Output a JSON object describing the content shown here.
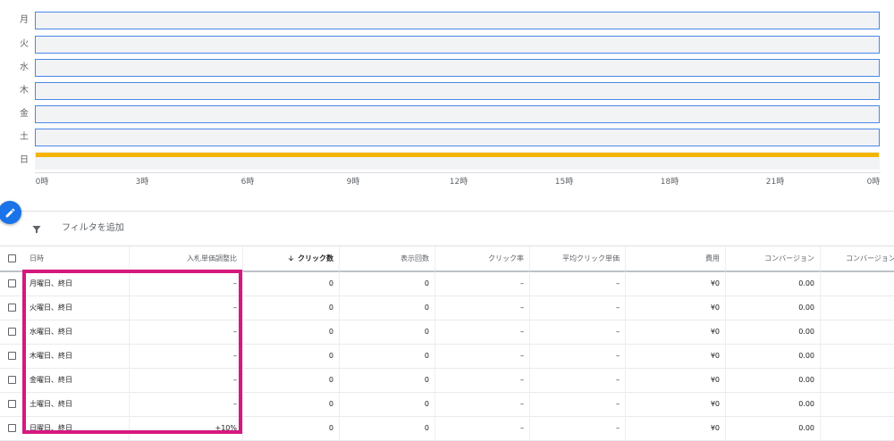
{
  "schedule": {
    "days": [
      "月",
      "火",
      "水",
      "木",
      "金",
      "土",
      "日"
    ],
    "highlighted_day_index": 6,
    "ticks": [
      "0時",
      "3時",
      "6時",
      "9時",
      "12時",
      "15時",
      "18時",
      "21時",
      "0時"
    ],
    "colors": {
      "bar_border": "#4a86e8",
      "bar_bg": "#f1f3f4",
      "adjustment_fill": "#f4b400"
    }
  },
  "toolbar": {
    "edit_icon": "pencil-icon",
    "filter_icon": "filter-funnel-icon",
    "add_filter_label": "フィルタを追加"
  },
  "table": {
    "headers": {
      "schedule": "日時",
      "bid_adjustment": "入札単価調整比",
      "clicks": "クリック数",
      "impressions": "表示回数",
      "ctr": "クリック率",
      "avg_cpc": "平均クリック単価",
      "cost": "費用",
      "conversions": "コンバージョン",
      "conversions_2": "コンバージョン"
    },
    "sort_icon": "arrow-down-icon",
    "rows": [
      {
        "schedule": "月曜日、終日",
        "bid_adjustment": "–",
        "clicks": "0",
        "impressions": "0",
        "ctr": "–",
        "avg_cpc": "–",
        "cost": "¥0",
        "conversions": "0.00"
      },
      {
        "schedule": "火曜日、終日",
        "bid_adjustment": "–",
        "clicks": "0",
        "impressions": "0",
        "ctr": "–",
        "avg_cpc": "–",
        "cost": "¥0",
        "conversions": "0.00"
      },
      {
        "schedule": "水曜日、終日",
        "bid_adjustment": "–",
        "clicks": "0",
        "impressions": "0",
        "ctr": "–",
        "avg_cpc": "–",
        "cost": "¥0",
        "conversions": "0.00"
      },
      {
        "schedule": "木曜日、終日",
        "bid_adjustment": "–",
        "clicks": "0",
        "impressions": "0",
        "ctr": "–",
        "avg_cpc": "–",
        "cost": "¥0",
        "conversions": "0.00"
      },
      {
        "schedule": "金曜日、終日",
        "bid_adjustment": "–",
        "clicks": "0",
        "impressions": "0",
        "ctr": "–",
        "avg_cpc": "–",
        "cost": "¥0",
        "conversions": "0.00"
      },
      {
        "schedule": "土曜日、終日",
        "bid_adjustment": "–",
        "clicks": "0",
        "impressions": "0",
        "ctr": "–",
        "avg_cpc": "–",
        "cost": "¥0",
        "conversions": "0.00"
      },
      {
        "schedule": "日曜日、終日",
        "bid_adjustment": "+10%",
        "clicks": "0",
        "impressions": "0",
        "ctr": "–",
        "avg_cpc": "–",
        "cost": "¥0",
        "conversions": "0.00"
      }
    ],
    "highlight_color": "#d6187f"
  }
}
